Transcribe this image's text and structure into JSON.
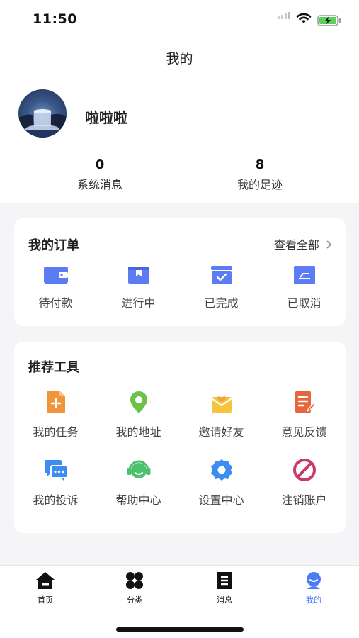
{
  "status_bar": {
    "time": "11:50"
  },
  "nav": {
    "title": "我的"
  },
  "profile": {
    "username": "啦啦啦"
  },
  "stats": [
    {
      "value": "0",
      "label": "系统消息"
    },
    {
      "value": "8",
      "label": "我的足迹"
    }
  ],
  "orders": {
    "title": "我的订单",
    "view_all": "查看全部",
    "items": [
      {
        "label": "待付款",
        "icon": "wallet-icon"
      },
      {
        "label": "进行中",
        "icon": "bookmark-box-icon"
      },
      {
        "label": "已完成",
        "icon": "check-box-icon"
      },
      {
        "label": "已取消",
        "icon": "cancel-box-icon"
      }
    ]
  },
  "tools": {
    "title": "推荐工具",
    "items": [
      {
        "label": "我的任务",
        "icon": "task-file-icon",
        "color": "#f0953a"
      },
      {
        "label": "我的地址",
        "icon": "location-pin-icon",
        "color": "#6cc24a"
      },
      {
        "label": "邀请好友",
        "icon": "mail-heart-icon",
        "color": "#f5c542"
      },
      {
        "label": "意见反馈",
        "icon": "feedback-doc-icon",
        "color": "#e8663d"
      },
      {
        "label": "我的投诉",
        "icon": "chat-bubbles-icon",
        "color": "#3d8df0"
      },
      {
        "label": "帮助中心",
        "icon": "headset-icon",
        "color": "#4cc06a"
      },
      {
        "label": "设置中心",
        "icon": "gear-icon",
        "color": "#3d8df0"
      },
      {
        "label": "注销账户",
        "icon": "prohibited-icon",
        "color": "#c83a6e"
      }
    ]
  },
  "tabbar": {
    "items": [
      {
        "label": "首页",
        "icon": "home-icon"
      },
      {
        "label": "分类",
        "icon": "category-icon"
      },
      {
        "label": "消息",
        "icon": "message-list-icon"
      },
      {
        "label": "我的",
        "icon": "profile-icon",
        "active": true
      }
    ]
  },
  "colors": {
    "accent": "#4a7cf6",
    "order_icon": "#5b7cf3"
  }
}
